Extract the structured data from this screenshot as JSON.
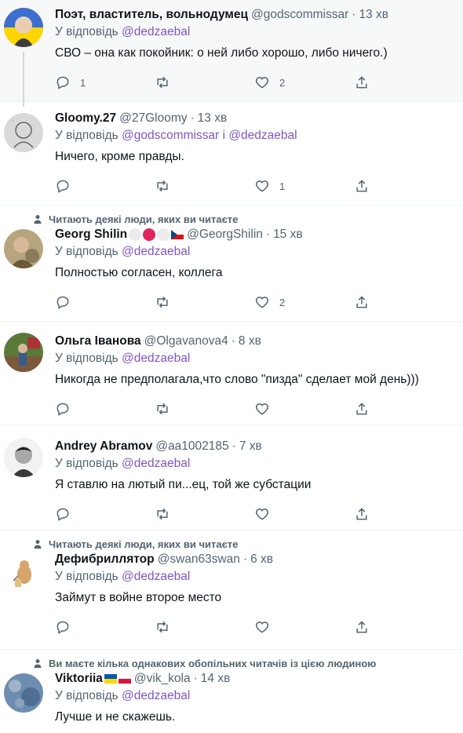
{
  "icons": {
    "reply": "reply-icon",
    "retweet": "retweet-icon",
    "like": "heart-icon",
    "share": "share-icon",
    "person": "person-icon"
  },
  "colors": {
    "mention": "#7e57c2",
    "secondary": "#536471",
    "divider": "#eff3f4",
    "highlight": "#f7f9f9"
  },
  "tweets": [
    {
      "name": "Поэт, властитель, вольнодумец",
      "handle": "@godscommissar",
      "dot": "·",
      "time": "13 хв",
      "reply_prefix": "У відповідь",
      "mentions": "@dedzaebal",
      "text": "СВО – она как покойник: о ней либо хорошо, либо ничего.)",
      "replies": "1",
      "retweets": "",
      "likes": "2"
    },
    {
      "name": "Gloomy.27",
      "handle": "@27Gloomy",
      "dot": "·",
      "time": "13 хв",
      "reply_prefix": "У відповідь",
      "mentions": "@godscommissar і @dedzaebal",
      "text": "Ничего, кроме правды.",
      "replies": "",
      "retweets": "",
      "likes": "1"
    },
    {
      "social": "Читають деякі люди, яких ви читаєте",
      "name": "Georg Shilin",
      "handle": "@GeorgShilin",
      "dot": "·",
      "time": "15 хв",
      "reply_prefix": "У відповідь",
      "mentions": "@dedzaebal",
      "text": "Полностью согласен, коллега",
      "replies": "",
      "retweets": "",
      "likes": "2"
    },
    {
      "name": "Ольга Іванова",
      "handle": "@Olgavanova4",
      "dot": "·",
      "time": "8 хв",
      "reply_prefix": "У відповідь",
      "mentions": "@dedzaebal",
      "text": "Никогда не предполагала,что слово \"пизда\" сделает мой день)))",
      "replies": "",
      "retweets": "",
      "likes": ""
    },
    {
      "name": "Andrey Abramov",
      "handle": "@aa1002185",
      "dot": "·",
      "time": "7 хв",
      "reply_prefix": "У відповідь",
      "mentions": "@dedzaebal",
      "text": "Я ставлю на лютый пи...ец, той же субстации",
      "replies": "",
      "retweets": "",
      "likes": ""
    },
    {
      "social": "Читають деякі люди, яких ви читаєте",
      "name": "Дефибриллятор",
      "handle": "@swan63swan",
      "dot": "·",
      "time": "6 хв",
      "reply_prefix": "У відповідь",
      "mentions": "@dedzaebal",
      "text": "Займут в войне второе место",
      "replies": "",
      "retweets": "",
      "likes": ""
    },
    {
      "social": "Ви маєте кілька однакових обопільних читачів із цією людиною",
      "name": "Viktoriia",
      "handle": "@vik_kola",
      "dot": "·",
      "time": "14 хв",
      "reply_prefix": "У відповідь",
      "mentions": "@dedzaebal",
      "text": "Лучше и не скажешь."
    }
  ]
}
